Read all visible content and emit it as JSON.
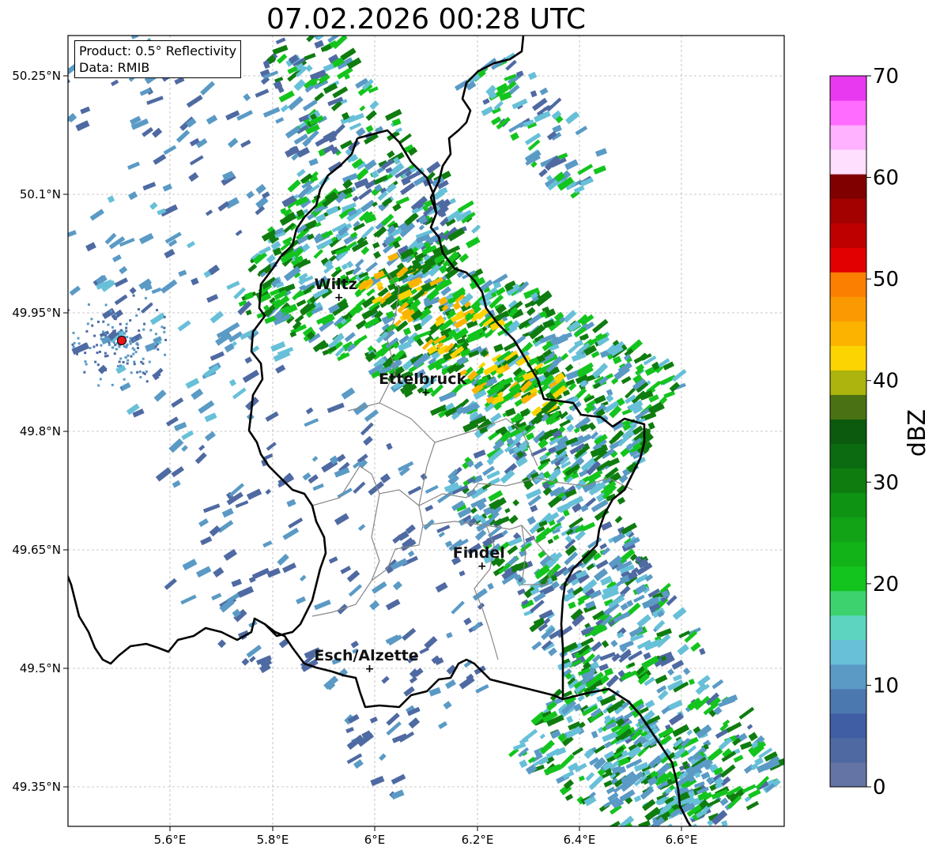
{
  "title": "07.02.2026 00:28 UTC",
  "info_box": {
    "product": "Product: 0.5° Reflectivity",
    "data": "Data: RMIB"
  },
  "lat_ticks": [
    "50.25°N",
    "50.1°N",
    "49.95°N",
    "49.8°N",
    "49.65°N",
    "49.5°N",
    "49.35°N"
  ],
  "lon_ticks": [
    "5.6°E",
    "5.8°E",
    "6°E",
    "6.2°E",
    "6.4°E",
    "6.6°E"
  ],
  "cities": [
    {
      "name": "Wiltz",
      "lon": 5.93,
      "lat": 49.97
    },
    {
      "name": "Ettelbruck",
      "lon": 6.1,
      "lat": 49.85
    },
    {
      "name": "Findel",
      "lon": 6.21,
      "lat": 49.63
    },
    {
      "name": "Esch/Alzette",
      "lon": 5.99,
      "lat": 49.5
    }
  ],
  "radar_site": {
    "lon": 5.505,
    "lat": 49.915,
    "color": "#e8151b"
  },
  "colorbar": {
    "label": "dBZ",
    "min": 0,
    "max": 70,
    "ticks": [
      "0",
      "10",
      "20",
      "30",
      "40",
      "50",
      "60",
      "70"
    ],
    "colors": [
      "#6474a4",
      "#4f6aa2",
      "#3f5ea3",
      "#4b78ae",
      "#5a9ac5",
      "#67c0d8",
      "#5dd4c0",
      "#3ed26e",
      "#14c41e",
      "#12b318",
      "#12a416",
      "#0e9412",
      "#0f7c10",
      "#0c6a10",
      "#0b5a0d",
      "#4a7214",
      "#acb40d",
      "#fcd402",
      "#fbb300",
      "#fb9902",
      "#fb7f00",
      "#e20000",
      "#be0000",
      "#a30000",
      "#800000",
      "#fedffe",
      "#ffb2ff",
      "#ff6cff",
      "#e939f0"
    ]
  },
  "precip_colors": {
    "light": "#4f6aa2",
    "blue": "#5a9ac5",
    "cyan": "#67c0d8",
    "green": "#14c41e",
    "dark_green": "#0f7c10",
    "yellow": "#fcd402",
    "orange": "#fbb300"
  }
}
